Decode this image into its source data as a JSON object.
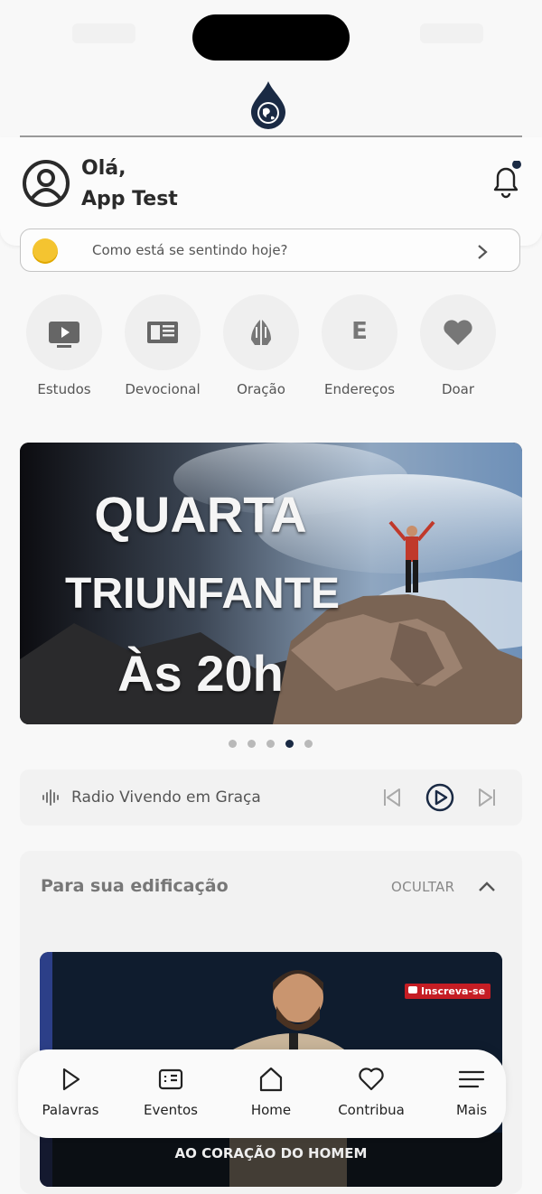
{
  "header": {
    "greeting_line1": "Olá,",
    "greeting_line2": "App Test",
    "notification_dot": true
  },
  "mood": {
    "prompt": "Como está se sentindo hoje?"
  },
  "quick_actions": [
    {
      "label": "Estudos",
      "icon": "video-play-icon"
    },
    {
      "label": "Devocional",
      "icon": "book-open-icon"
    },
    {
      "label": "Oração",
      "icon": "praying-hands-icon"
    },
    {
      "label": "Endereços",
      "icon": "letter-e-icon",
      "letter": "E"
    },
    {
      "label": "Doar",
      "icon": "heart-icon"
    }
  ],
  "banner": {
    "line1": "QUARTA",
    "line2": "TRIUNFANTE",
    "line3": "Às 20h",
    "page_count": 5,
    "active_page": 4
  },
  "radio": {
    "title": "Radio Vivendo em Graça"
  },
  "edification": {
    "title": "Para sua edificação",
    "hide_label": "OCULTAR",
    "video": {
      "subscribe_label": "Inscreva-se",
      "caption": "AO CORAÇÃO DO HOMEM"
    }
  },
  "tabbar": [
    {
      "label": "Palavras",
      "icon": "play-icon"
    },
    {
      "label": "Eventos",
      "icon": "calendar-icon"
    },
    {
      "label": "Home",
      "icon": "home-icon"
    },
    {
      "label": "Contribua",
      "icon": "heart-icon"
    },
    {
      "label": "Mais",
      "icon": "menu-icon"
    }
  ],
  "colors": {
    "accent": "#1a2a44",
    "background": "#f8f8f8",
    "icon_grey": "#777777"
  }
}
